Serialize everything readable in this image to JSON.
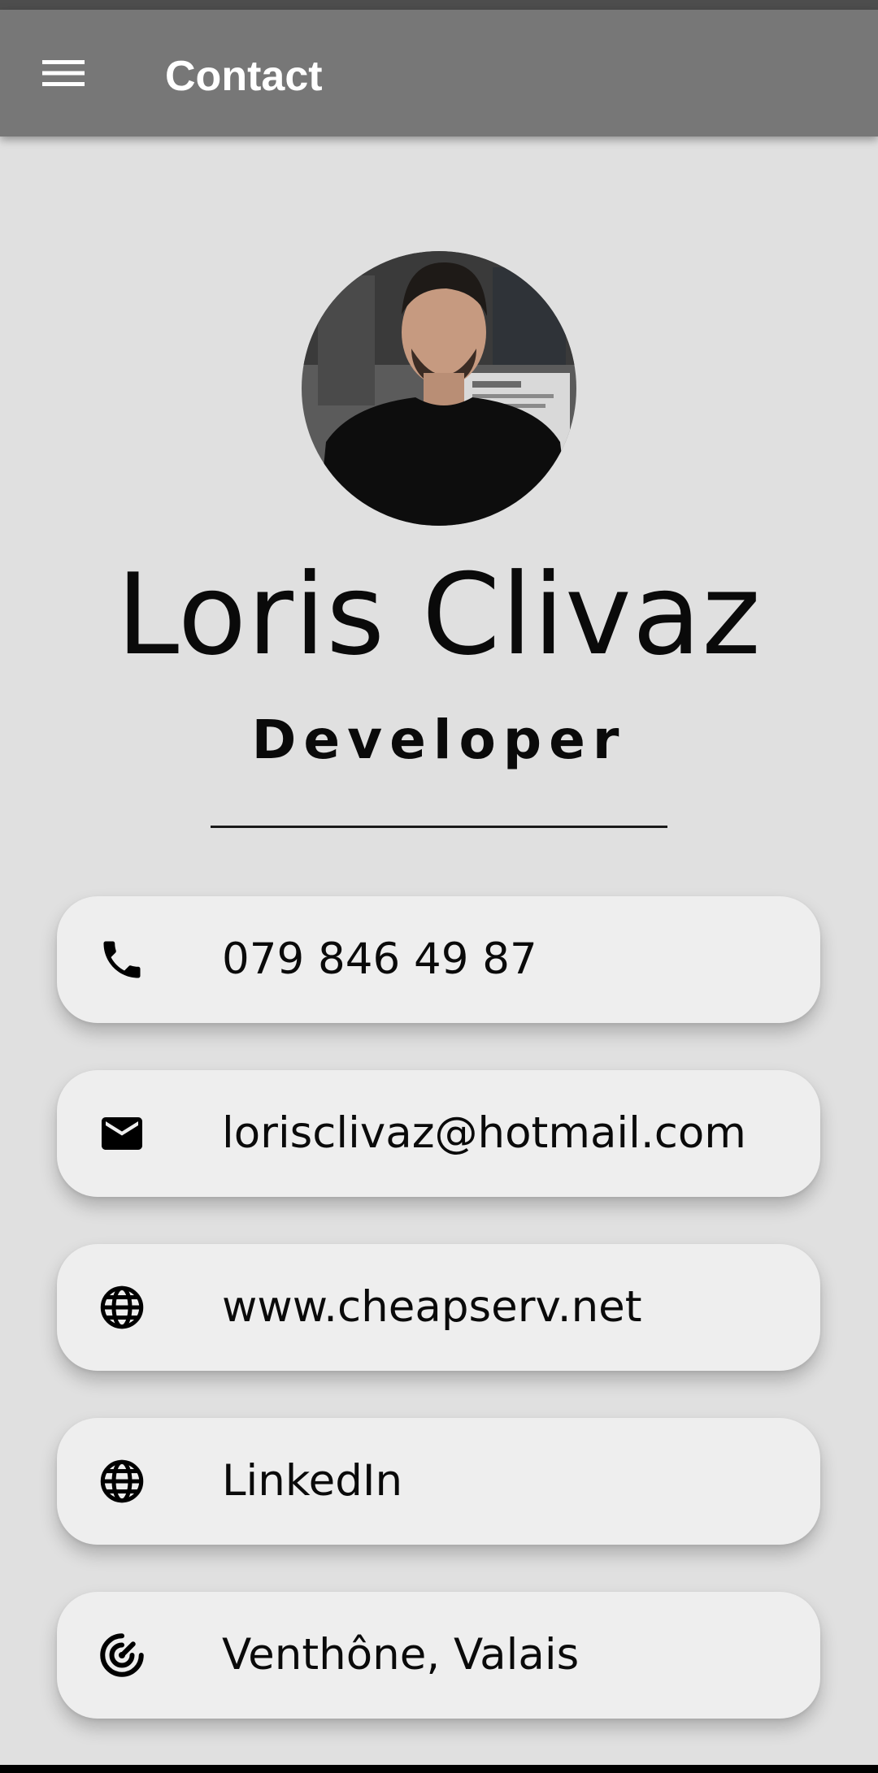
{
  "app_bar": {
    "title": "Contact",
    "menu_icon": "hamburger-menu-icon",
    "background": "#777777"
  },
  "profile": {
    "name": "Loris Clivaz",
    "role": "Developer"
  },
  "contacts": [
    {
      "icon": "phone-icon",
      "text": "079 846 49 87"
    },
    {
      "icon": "email-icon",
      "text": "lorisclivaz@hotmail.com"
    },
    {
      "icon": "globe-icon",
      "text": "www.cheapserv.net"
    },
    {
      "icon": "globe-icon",
      "text": "LinkedIn"
    },
    {
      "icon": "location-icon",
      "text": "Venthône, Valais"
    }
  ],
  "colors": {
    "page_background": "#e0e0e0",
    "card_background": "#eeeeee",
    "text": "#0a0a0a"
  }
}
